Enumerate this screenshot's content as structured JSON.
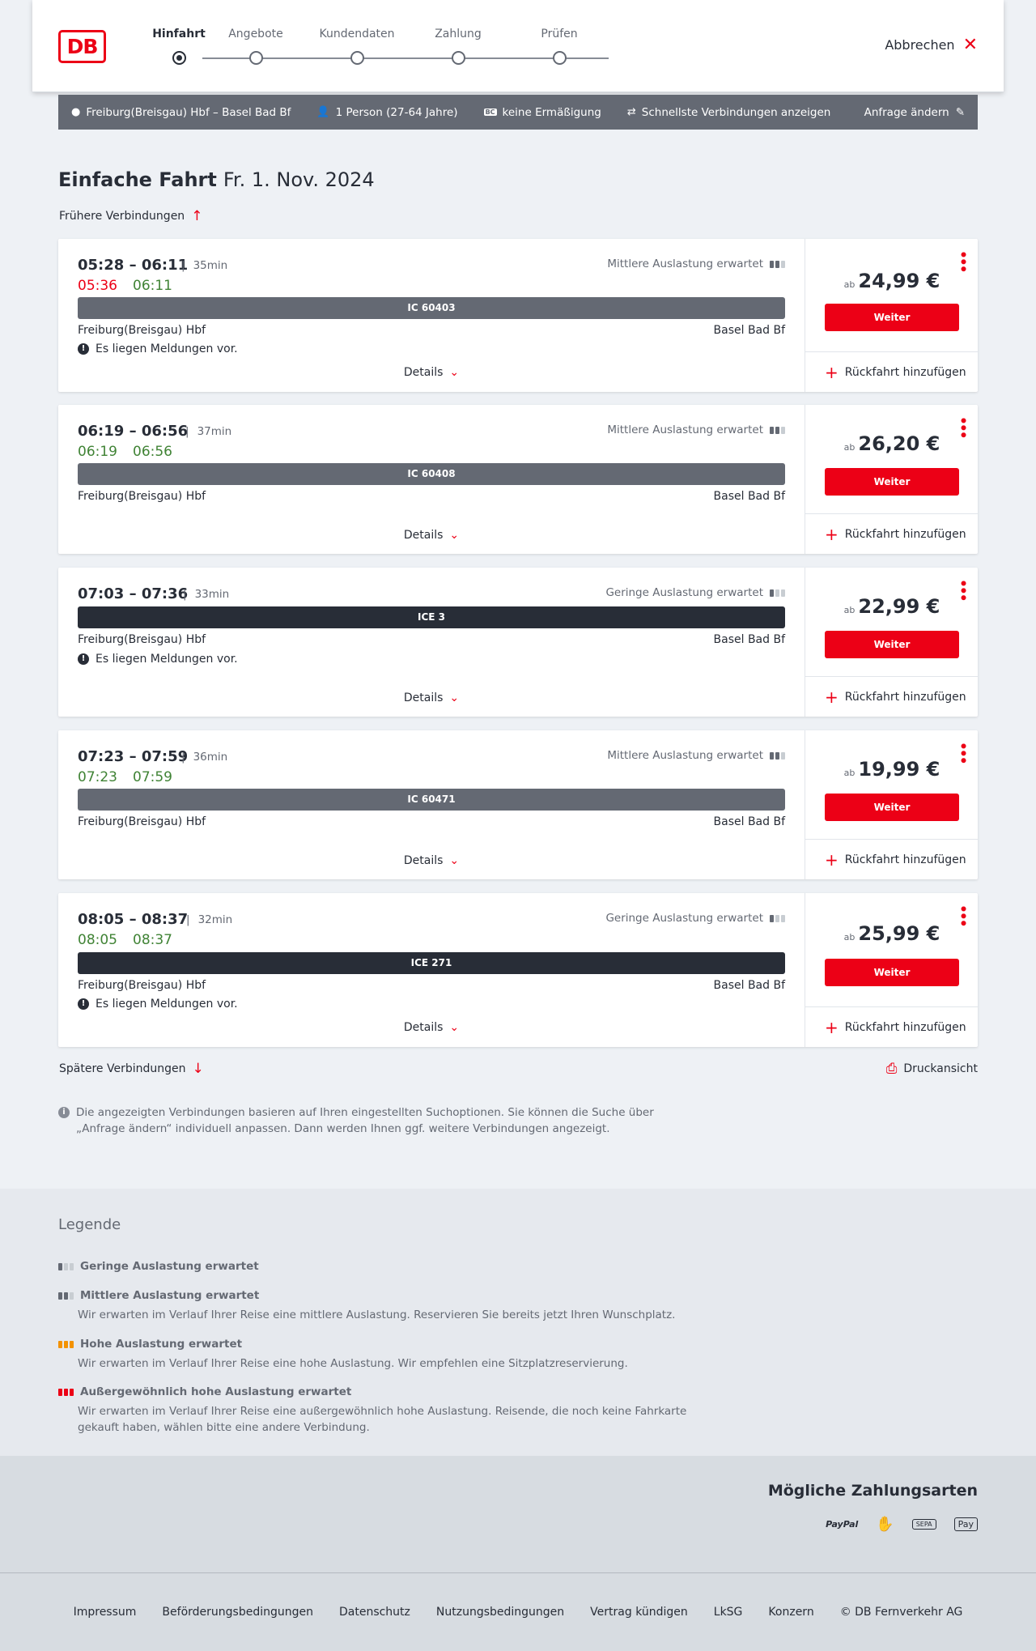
{
  "header": {
    "logo": "DB",
    "cancel": "Abbrechen",
    "steps": [
      "Hinfahrt",
      "Angebote",
      "Kundendaten",
      "Zahlung",
      "Prüfen"
    ]
  },
  "infobar": {
    "route": "Freiburg(Breisgau) Hbf – Basel Bad Bf",
    "persons": "1 Person (27-64 Jahre)",
    "discount": "keine Ermäßigung",
    "bc_badge": "BC",
    "fastest": "Schnellste Verbindungen anzeigen",
    "edit": "Anfrage ändern"
  },
  "title": {
    "main": "Einfache Fahrt",
    "date": "Fr. 1. Nov. 2024"
  },
  "earlier": "Frühere Verbindungen",
  "later": "Spätere Verbindungen",
  "print": "Druckansicht",
  "connections": [
    {
      "times": "05:28 – 06:11",
      "dur": "35min",
      "rt_dep": "05:36",
      "rt_arr": "06:11",
      "load": "Mittlere Auslastung erwartet",
      "train": "IC 60403",
      "from": "Freiburg(Breisgau) Hbf",
      "to": "Basel Bad Bf",
      "msg": "Es liegen Meldungen vor.",
      "details": "Details",
      "ab": "ab",
      "price": "24,99 €",
      "weiter": "Weiter",
      "ret": "Rückfahrt hinzufügen"
    },
    {
      "times": "06:19 – 06:56",
      "dur": "37min",
      "rt_dep": "06:19",
      "rt_arr": "06:56",
      "load": "Mittlere Auslastung erwartet",
      "train": "IC 60408",
      "from": "Freiburg(Breisgau) Hbf",
      "to": "Basel Bad Bf",
      "details": "Details",
      "ab": "ab",
      "price": "26,20 €",
      "weiter": "Weiter",
      "ret": "Rückfahrt hinzufügen"
    },
    {
      "times": "07:03 – 07:36",
      "dur": "33min",
      "load": "Geringe Auslastung erwartet",
      "train": "ICE 3",
      "from": "Freiburg(Breisgau) Hbf",
      "to": "Basel Bad Bf",
      "msg": "Es liegen Meldungen vor.",
      "details": "Details",
      "ab": "ab",
      "price": "22,99 €",
      "weiter": "Weiter",
      "ret": "Rückfahrt hinzufügen"
    },
    {
      "times": "07:23 – 07:59",
      "dur": "36min",
      "rt_dep": "07:23",
      "rt_arr": "07:59",
      "load": "Mittlere Auslastung erwartet",
      "train": "IC 60471",
      "from": "Freiburg(Breisgau) Hbf",
      "to": "Basel Bad Bf",
      "details": "Details",
      "ab": "ab",
      "price": "19,99 €",
      "weiter": "Weiter",
      "ret": "Rückfahrt hinzufügen"
    },
    {
      "times": "08:05 – 08:37",
      "dur": "32min",
      "rt_dep": "08:05",
      "rt_arr": "08:37",
      "load": "Geringe Auslastung erwartet",
      "train": "ICE 271",
      "from": "Freiburg(Breisgau) Hbf",
      "to": "Basel Bad Bf",
      "msg": "Es liegen Meldungen vor.",
      "details": "Details",
      "ab": "ab",
      "price": "25,99 €",
      "weiter": "Weiter",
      "ret": "Rückfahrt hinzufügen"
    }
  ],
  "note": "Die angezeigten Verbindungen basieren auf Ihren eingestellten Suchoptionen. Sie können die Suche über „Anfrage ändern“ individuell anpassen. Dann werden Ihnen ggf. weitere Verbindungen angezeigt.",
  "legend": {
    "title": "Legende",
    "items": [
      {
        "t": "Geringe Auslastung erwartet",
        "d": ""
      },
      {
        "t": "Mittlere Auslastung erwartet",
        "d": "Wir erwarten im Verlauf Ihrer Reise eine mittlere Auslastung. Reservieren Sie bereits jetzt Ihren Wunschplatz."
      },
      {
        "t": "Hohe Auslastung erwartet",
        "d": "Wir erwarten im Verlauf Ihrer Reise eine hohe Auslastung. Wir empfehlen eine Sitzplatzreservierung."
      },
      {
        "t": "Außergewöhnlich hohe Auslastung erwartet",
        "d": "Wir erwarten im Verlauf Ihrer Reise eine außergewöhnlich hohe Auslastung. Reisende, die noch keine Fahrkarte gekauft haben, wählen bitte eine andere Verbindung."
      }
    ]
  },
  "payments": {
    "title": "Mögliche Zahlungsarten",
    "paypal": "PayPal",
    "sepa": "SEPA",
    "applepay": "Pay"
  },
  "footer": [
    "Impressum",
    "Beförderungsbedingungen",
    "Datenschutz",
    "Nutzungsbedingungen",
    "Vertrag kündigen",
    "LkSG",
    "Konzern",
    "© DB Fernverkehr AG"
  ],
  "colors": {
    "brand_red": "#ec0016",
    "realtime_green": "#408335",
    "dark": "#282d37",
    "grey": "#646973"
  }
}
